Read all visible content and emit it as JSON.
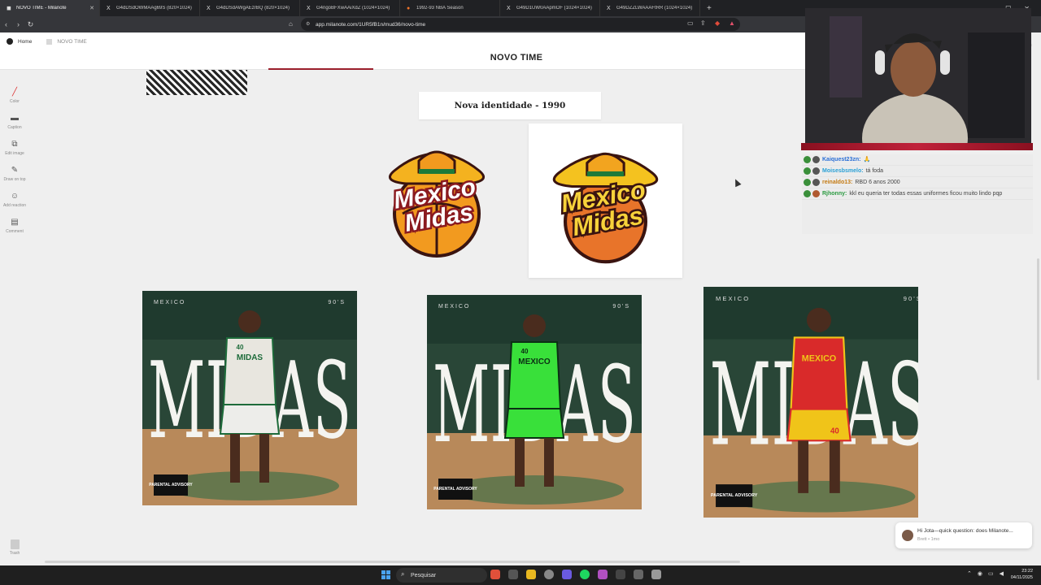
{
  "browser": {
    "tabs": [
      {
        "title": "NOVO TIME - Milanote",
        "active": true,
        "icon": "milanote-icon"
      },
      {
        "title": "G4dDSdOWMAAg69S (820×1024)",
        "active": false,
        "icon": "x-icon"
      },
      {
        "title": "G4dDSdAWgAEzrBQ (820×1024)",
        "active": false,
        "icon": "x-icon"
      },
      {
        "title": "G4ngoBFXwAAiXdZ (1024×1024)",
        "active": false,
        "icon": "x-icon"
      },
      {
        "title": "1992-93 NBA Season",
        "active": false,
        "icon": "fire-icon"
      },
      {
        "title": "G49D1UW0AApmOF (1024×1024)",
        "active": false,
        "icon": "x-icon"
      },
      {
        "title": "G49DZZLWAAAFtRR (1024×1024)",
        "active": false,
        "icon": "x-icon"
      }
    ],
    "url": "app.milanote.com/1UR5fB1n/mud36/novo-time"
  },
  "app": {
    "breadcrumb_home": "Home",
    "breadcrumb_board": "NOVO TIME",
    "board_title": "NOVO TIME",
    "toolbar": [
      {
        "label": "Color",
        "icon": "pen-color-icon"
      },
      {
        "label": "Caption",
        "icon": "caption-icon"
      },
      {
        "label": "Edit image",
        "icon": "crop-icon"
      },
      {
        "label": "Draw on top",
        "icon": "pencil-icon"
      },
      {
        "label": "Add reaction",
        "icon": "smile-icon"
      },
      {
        "label": "Comment",
        "icon": "comment-icon"
      }
    ],
    "trash_label": "Trash"
  },
  "canvas": {
    "caption_card": "Nova identidade - 1990",
    "logo_line1": "Mexico",
    "logo_line2": "Midas",
    "posters": [
      {
        "top_left": "M E X I C O",
        "top_right": "9 0 ' S",
        "big": "MIDAS",
        "jersey": "MIDAS",
        "number": "40",
        "jersey_color": "#e8e6df",
        "shorts_color": "#ededea",
        "trim_color": "#1d6b3a",
        "advisory": "PARENTAL ADVISORY"
      },
      {
        "top_left": "M E X I C O",
        "top_right": "9 0 ' S",
        "big": "MIDAS",
        "jersey": "MEXICO",
        "number": "40",
        "jersey_color": "#39e03a",
        "shorts_color": "#39e03a",
        "trim_color": "#0b2f14",
        "advisory": "PARENTAL ADVISORY"
      },
      {
        "top_left": "M E X I C O",
        "top_right": "9 0 ' S",
        "big": "MIDAS",
        "jersey": "MEXICO",
        "number": "40",
        "jersey_color": "#d92a2a",
        "shorts_color": "#f0c419",
        "trim_color": "#f0c419",
        "advisory": "PARENTAL ADVISORY"
      }
    ]
  },
  "stream": {
    "chat": [
      {
        "user": "Kaiquest23zn:",
        "text": "🙏"
      },
      {
        "user": "Moisesbsmelo:",
        "text": "tá foda"
      },
      {
        "user": "reinaldo13:",
        "text": "RBD 6 anos 2000"
      },
      {
        "user": "Rjhonny:",
        "text": "kkl eu queria ter todas essas uniformes ficou muito lindo pqp"
      }
    ]
  },
  "toast": {
    "message": "Hi Jota—quick question: does Milanote...",
    "meta": "Brett • 1mo"
  },
  "taskbar": {
    "search_placeholder": "Pesquisar",
    "time": "23:22",
    "date": "04/11/2025"
  },
  "colors": {
    "accent": "#9b1f2c",
    "logo_orange": "#f29a1f",
    "logo_red": "#8a1a1f"
  }
}
